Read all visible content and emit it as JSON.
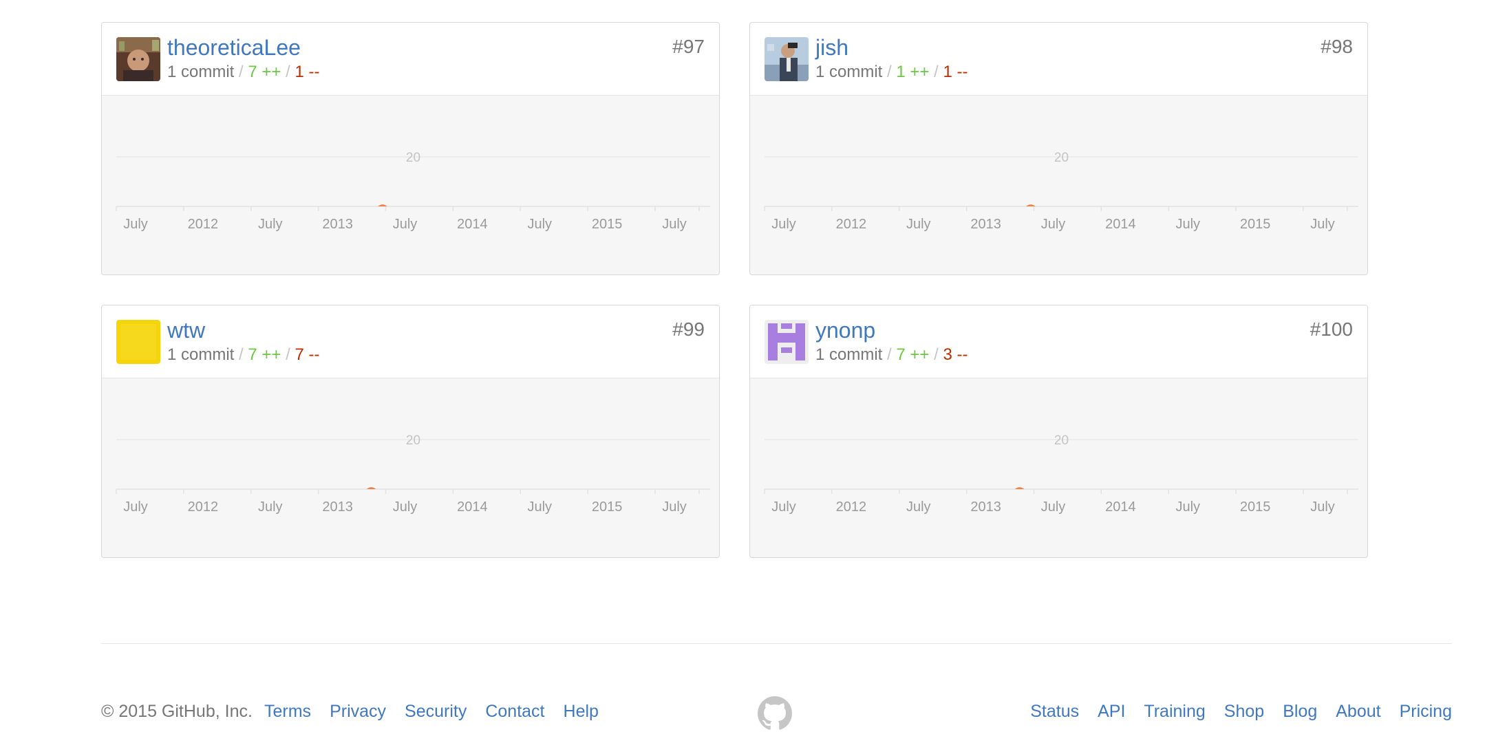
{
  "contributors": [
    {
      "username": "theoreticaLee",
      "rank": "#97",
      "commits": "1 commit",
      "additions": "7 ++",
      "deletions": "1 --",
      "avatar": "photo-avatar"
    },
    {
      "username": "jish",
      "rank": "#98",
      "commits": "1 commit",
      "additions": "1 ++",
      "deletions": "1 --",
      "avatar": "photo-avatar"
    },
    {
      "username": "wtw",
      "rank": "#99",
      "commits": "1 commit",
      "additions": "7 ++",
      "deletions": "7 --",
      "avatar": "identicon-yellow"
    },
    {
      "username": "ynonp",
      "rank": "#100",
      "commits": "1 commit",
      "additions": "7 ++",
      "deletions": "3 --",
      "avatar": "identicon-purple"
    }
  ],
  "chart_data": [
    {
      "type": "area",
      "x_tick_labels": [
        "July",
        "2012",
        "July",
        "2013",
        "July",
        "2014",
        "July",
        "2015",
        "July"
      ],
      "y_tick_labels": [
        "20"
      ],
      "ylim": [
        0,
        20
      ],
      "series": [
        {
          "x": [
            "2013-05"
          ],
          "values": [
            1
          ]
        }
      ],
      "color": "#f17f42"
    },
    {
      "type": "area",
      "x_tick_labels": [
        "July",
        "2012",
        "July",
        "2013",
        "July",
        "2014",
        "July",
        "2015",
        "July"
      ],
      "y_tick_labels": [
        "20"
      ],
      "ylim": [
        0,
        20
      ],
      "series": [
        {
          "x": [
            "2013-05"
          ],
          "values": [
            1
          ]
        }
      ],
      "color": "#f17f42"
    },
    {
      "type": "area",
      "x_tick_labels": [
        "July",
        "2012",
        "July",
        "2013",
        "July",
        "2014",
        "July",
        "2015",
        "July"
      ],
      "y_tick_labels": [
        "20"
      ],
      "ylim": [
        0,
        20
      ],
      "series": [
        {
          "x": [
            "2013-04"
          ],
          "values": [
            1
          ]
        }
      ],
      "color": "#f17f42"
    },
    {
      "type": "area",
      "x_tick_labels": [
        "July",
        "2012",
        "July",
        "2013",
        "July",
        "2014",
        "July",
        "2015",
        "July"
      ],
      "y_tick_labels": [
        "20"
      ],
      "ylim": [
        0,
        20
      ],
      "series": [
        {
          "x": [
            "2013-04"
          ],
          "values": [
            1
          ]
        }
      ],
      "color": "#f17f42"
    }
  ],
  "footer": {
    "copyright": "© 2015 GitHub, Inc.",
    "links_left": [
      "Terms",
      "Privacy",
      "Security",
      "Contact",
      "Help"
    ],
    "links_right": [
      "Status",
      "API",
      "Training",
      "Shop",
      "Blog",
      "About",
      "Pricing"
    ],
    "logo": "github-octocat-icon"
  }
}
